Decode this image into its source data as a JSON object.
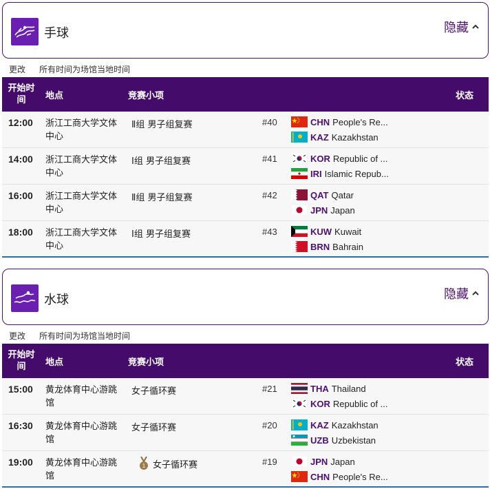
{
  "sections": [
    {
      "sport": "手球",
      "hide_label": "隐藏",
      "change_label": "更改",
      "timezone_note": "所有时间为场馆当地时间",
      "headers": {
        "time": "开始时\n间",
        "venue": "地点",
        "event": "竞赛小项",
        "status": "状态"
      },
      "rows": [
        {
          "time": "12:00",
          "venue": "浙江工商大学文体中心",
          "event": "Ⅱ组 男子组复赛",
          "match": "#40",
          "team1": {
            "code": "CHN",
            "name": "People's Re..."
          },
          "team2": {
            "code": "KAZ",
            "name": "Kazakhstan"
          }
        },
        {
          "time": "14:00",
          "venue": "浙江工商大学文体中心",
          "event": "Ⅰ组 男子组复赛",
          "match": "#41",
          "team1": {
            "code": "KOR",
            "name": "Republic of ..."
          },
          "team2": {
            "code": "IRI",
            "name": "Islamic Repub..."
          }
        },
        {
          "time": "16:00",
          "venue": "浙江工商大学文体中心",
          "event": "Ⅱ组 男子组复赛",
          "match": "#42",
          "team1": {
            "code": "QAT",
            "name": "Qatar"
          },
          "team2": {
            "code": "JPN",
            "name": "Japan"
          }
        },
        {
          "time": "18:00",
          "venue": "浙江工商大学文体中心",
          "event": "Ⅰ组 男子组复赛",
          "match": "#43",
          "team1": {
            "code": "KUW",
            "name": "Kuwait"
          },
          "team2": {
            "code": "BRN",
            "name": "Bahrain"
          }
        }
      ]
    },
    {
      "sport": "水球",
      "hide_label": "隐藏",
      "change_label": "更改",
      "timezone_note": "所有时间为场馆当地时间",
      "headers": {
        "time": "开始时\n间",
        "venue": "地点",
        "event": "竞赛小项",
        "status": "状态"
      },
      "rows": [
        {
          "time": "15:00",
          "venue": "黄龙体育中心游跳馆",
          "event": "女子循环赛",
          "match": "#21",
          "team1": {
            "code": "THA",
            "name": "Thailand"
          },
          "team2": {
            "code": "KOR",
            "name": "Republic of ..."
          }
        },
        {
          "time": "16:30",
          "venue": "黄龙体育中心游跳馆",
          "event": "女子循环赛",
          "match": "#20",
          "team1": {
            "code": "KAZ",
            "name": "Kazakhstan"
          },
          "team2": {
            "code": "UZB",
            "name": "Uzbekistan"
          }
        },
        {
          "time": "19:00",
          "venue": "黄龙体育中心游跳馆",
          "event": "女子循环赛",
          "match": "#19",
          "medal_icon": "medal-icon",
          "team1": {
            "code": "JPN",
            "name": "Japan"
          },
          "team2": {
            "code": "CHN",
            "name": "People's Re..."
          }
        }
      ]
    }
  ]
}
